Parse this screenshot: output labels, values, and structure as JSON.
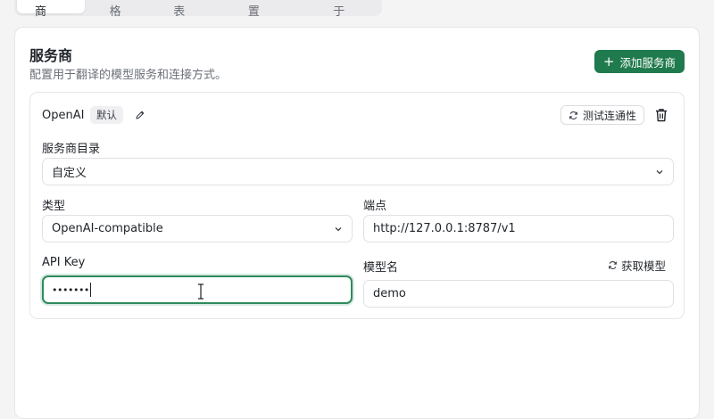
{
  "tabs": [
    {
      "label": "服务商",
      "active": true
    },
    {
      "label": "风格",
      "active": false
    },
    {
      "label": "术语表",
      "active": false
    },
    {
      "label": "偏好设置",
      "active": false
    },
    {
      "label": "关于",
      "active": false
    }
  ],
  "section": {
    "title": "服务商",
    "description": "配置用于翻译的模型服务和连接方式。",
    "add_button_label": "添加服务商"
  },
  "provider": {
    "name": "OpenAI",
    "badge": "默认",
    "test_button_label": "测试连通性",
    "catalog_label": "服务商目录",
    "catalog_value": "自定义",
    "type_label": "类型",
    "type_value": "OpenAI-compatible",
    "endpoint_label": "端点",
    "endpoint_value": "http://127.0.0.1:8787/v1",
    "api_key_label": "API Key",
    "api_key_value": "•••••••",
    "model_label": "模型名",
    "fetch_models_label": "获取模型",
    "model_value": "demo"
  },
  "colors": {
    "accent": "#1f7a4d",
    "focus": "#2f8a5c"
  },
  "icons": [
    "plus-icon",
    "edit-icon",
    "refresh-icon",
    "trash-icon",
    "chevron-down-icon",
    "text-cursor-icon"
  ]
}
